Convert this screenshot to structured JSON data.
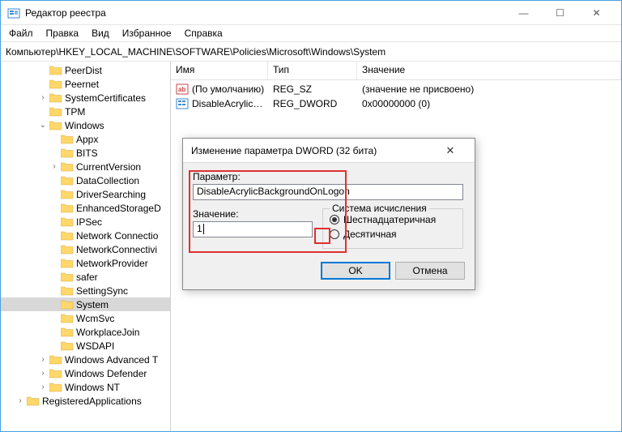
{
  "window": {
    "title": "Редактор реестра",
    "menu": [
      "Файл",
      "Правка",
      "Вид",
      "Избранное",
      "Справка"
    ],
    "address": "Компьютер\\HKEY_LOCAL_MACHINE\\SOFTWARE\\Policies\\Microsoft\\Windows\\System",
    "winbtn_min": "—",
    "winbtn_max": "☐",
    "winbtn_close": "✕"
  },
  "tree": {
    "items": [
      {
        "d": 3,
        "exp": "",
        "label": "PeerDist"
      },
      {
        "d": 3,
        "exp": "",
        "label": "Peernet"
      },
      {
        "d": 3,
        "exp": ">",
        "label": "SystemCertificates"
      },
      {
        "d": 3,
        "exp": "",
        "label": "TPM"
      },
      {
        "d": 3,
        "exp": "v",
        "label": "Windows"
      },
      {
        "d": 4,
        "exp": "",
        "label": "Appx"
      },
      {
        "d": 4,
        "exp": "",
        "label": "BITS"
      },
      {
        "d": 4,
        "exp": ">",
        "label": "CurrentVersion"
      },
      {
        "d": 4,
        "exp": "",
        "label": "DataCollection"
      },
      {
        "d": 4,
        "exp": "",
        "label": "DriverSearching"
      },
      {
        "d": 4,
        "exp": "",
        "label": "EnhancedStorageD"
      },
      {
        "d": 4,
        "exp": "",
        "label": "IPSec"
      },
      {
        "d": 4,
        "exp": "",
        "label": "Network Connectio"
      },
      {
        "d": 4,
        "exp": "",
        "label": "NetworkConnectivi"
      },
      {
        "d": 4,
        "exp": "",
        "label": "NetworkProvider"
      },
      {
        "d": 4,
        "exp": "",
        "label": "safer"
      },
      {
        "d": 4,
        "exp": "",
        "label": "SettingSync"
      },
      {
        "d": 4,
        "exp": "",
        "label": "System",
        "sel": true
      },
      {
        "d": 4,
        "exp": "",
        "label": "WcmSvc"
      },
      {
        "d": 4,
        "exp": "",
        "label": "WorkplaceJoin"
      },
      {
        "d": 4,
        "exp": "",
        "label": "WSDAPI"
      },
      {
        "d": 3,
        "exp": ">",
        "label": "Windows Advanced T"
      },
      {
        "d": 3,
        "exp": ">",
        "label": "Windows Defender"
      },
      {
        "d": 3,
        "exp": ">",
        "label": "Windows NT"
      },
      {
        "d": 1,
        "exp": ">",
        "label": "RegisteredApplications"
      }
    ]
  },
  "list": {
    "headers": {
      "name": "Имя",
      "type": "Тип",
      "value": "Значение"
    },
    "rows": [
      {
        "icon": "ab",
        "name": "(По умолчанию)",
        "type": "REG_SZ",
        "value": "(значение не присвоено)"
      },
      {
        "icon": "bin",
        "name": "DisableAcrylicBa...",
        "type": "REG_DWORD",
        "value": "0x00000000 (0)"
      }
    ]
  },
  "dialog": {
    "title": "Изменение параметра DWORD (32 бита)",
    "param_label": "Параметр:",
    "param_value": "DisableAcrylicBackgroundOnLogon",
    "value_label": "Значение:",
    "value_value": "1",
    "base_label": "Система исчисления",
    "radio_hex": "Шестнадцатеричная",
    "radio_dec": "Десятичная",
    "btn_ok": "OK",
    "btn_cancel": "Отмена"
  }
}
